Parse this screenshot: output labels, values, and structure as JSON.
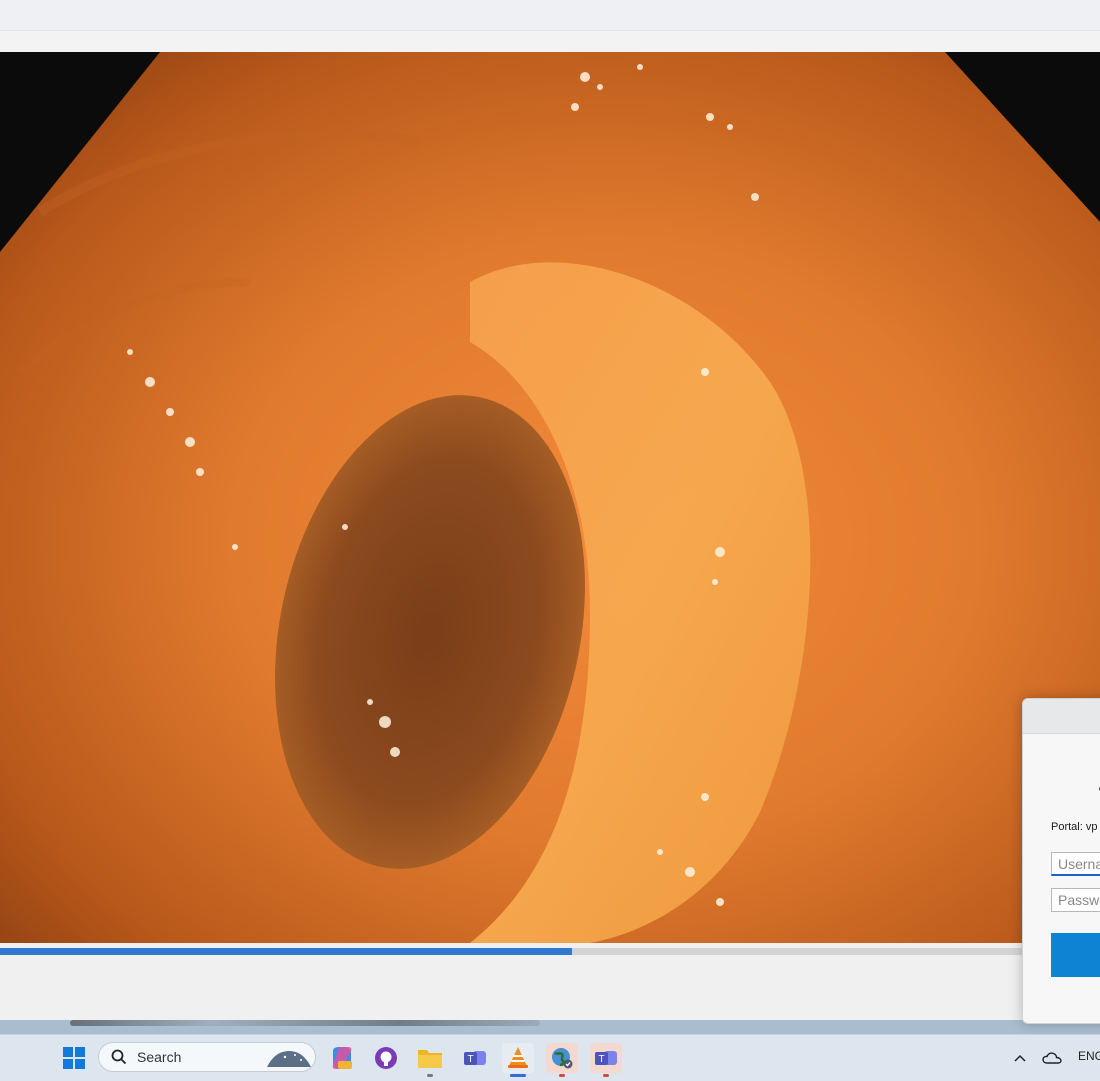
{
  "dialog": {
    "portal_text": "Portal: vp",
    "username_placeholder": "Userna",
    "password_placeholder": "Passwo"
  },
  "player": {
    "progress": 0.52
  },
  "taskbar": {
    "search_label": "Search",
    "tray_language": "ENG",
    "apps": [
      "windows-start-icon",
      "copilot-icon",
      "github-icon",
      "file-explorer-icon",
      "teams-icon",
      "vlc-icon",
      "vpn-globe-icon",
      "teams-work-icon"
    ]
  },
  "colors": {
    "accent": "#0e83d3",
    "seek_fill": "#2f79d1"
  }
}
